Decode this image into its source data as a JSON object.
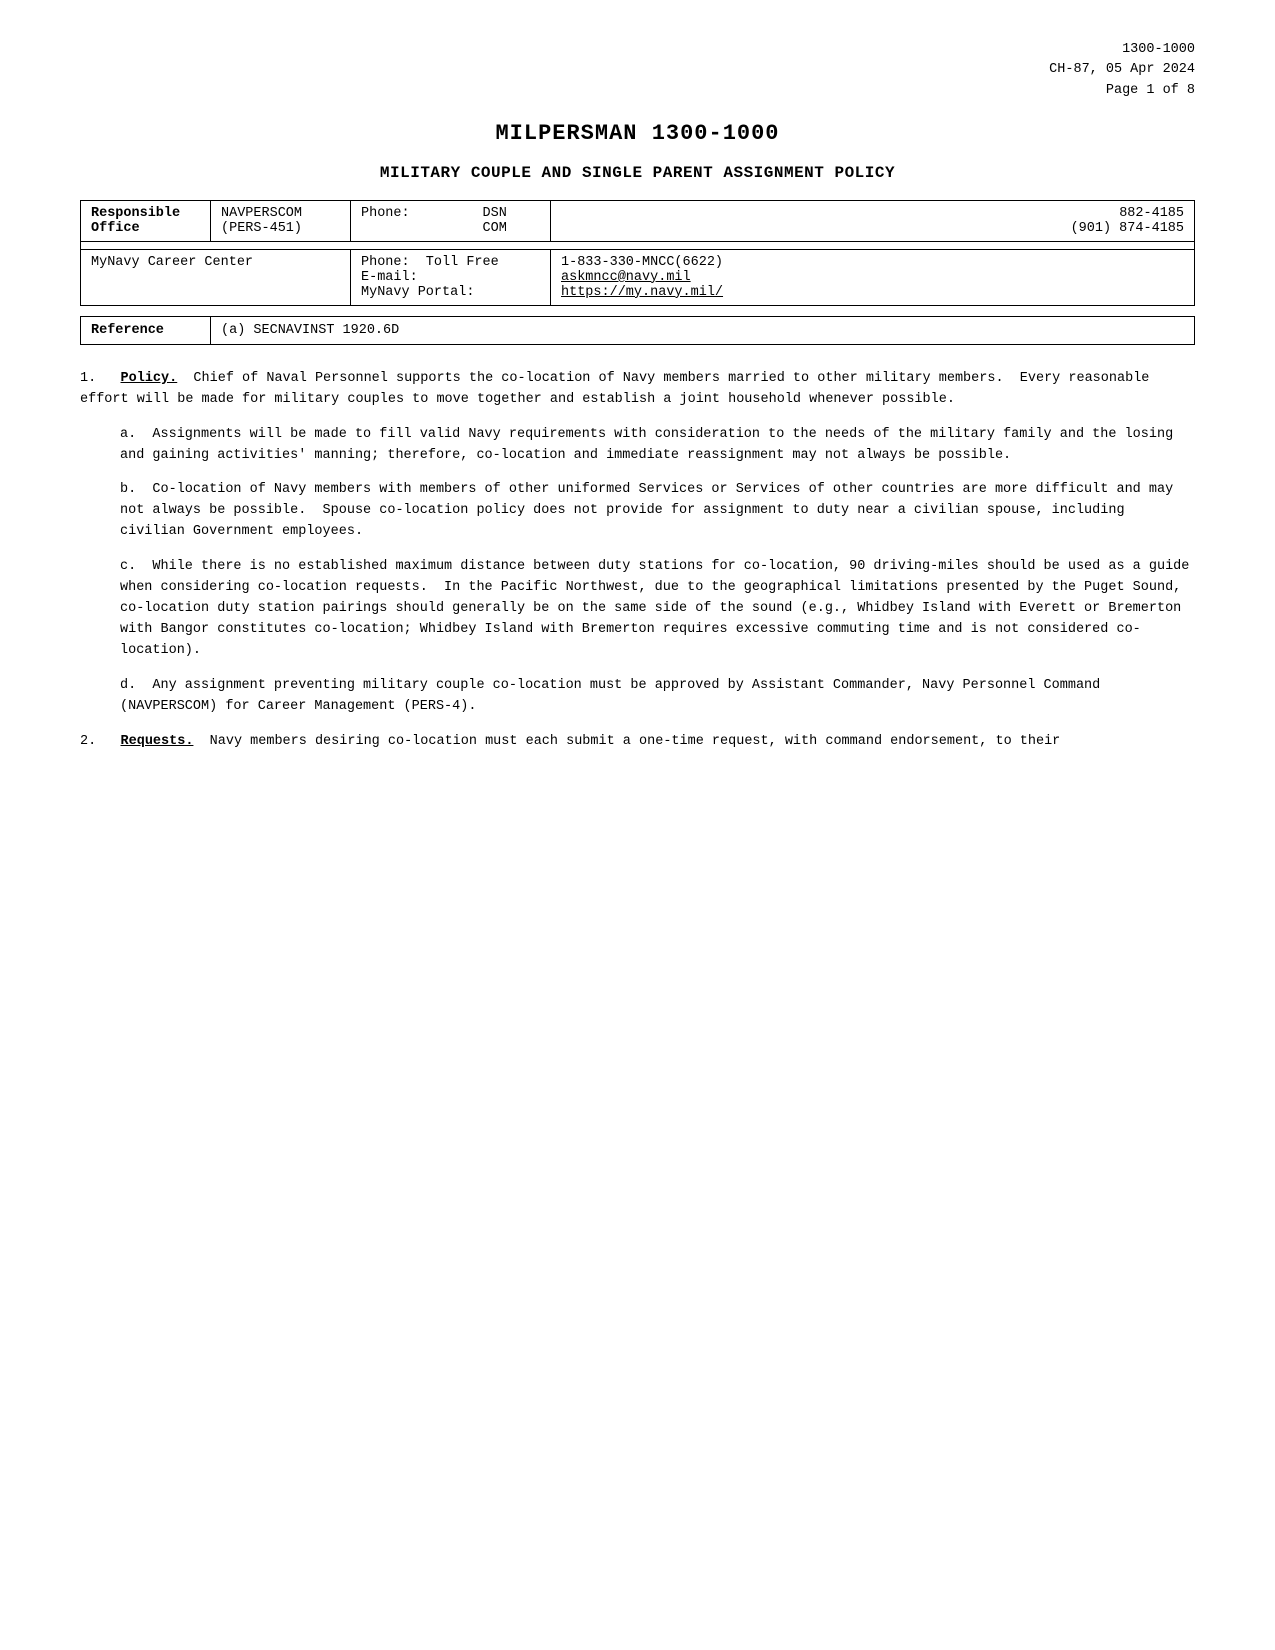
{
  "header": {
    "line1": "1300-1000",
    "line2": "CH-87, 05 Apr 2024",
    "line3": "Page 1 of 8"
  },
  "doc_title": "MILPERSMAN 1300-1000",
  "section_title": "Military Couple and Single Parent Assignment Policy",
  "table1": {
    "row1": {
      "col1_label": "Responsible\nOffice",
      "col2": "NAVPERSCOM\n(PERS-451)",
      "col3_label": "Phone:",
      "col3_dsn": "DSN",
      "col3_com": "COM",
      "col4_dsn_num": "882-4185",
      "col4_com_num": "(901) 874-4185"
    },
    "row2": {
      "col1": "MyNavy Career Center",
      "col2_label1": "Phone:",
      "col2_val1": "Toll Free",
      "col2_label2": "E-mail:",
      "col2_label3": "MyNavy Portal:",
      "col3_phone": "1-833-330-MNCC(6622)",
      "col3_email": "askmncc@navy.mil",
      "col3_portal": "https://my.navy.mil/"
    }
  },
  "ref_table": {
    "label": "Reference",
    "value": "(a) SECNAVINST 1920.6D"
  },
  "section1": {
    "num": "1.",
    "title": "Policy.",
    "text": "  Chief of Naval Personnel supports the co-location of Navy members married to other military members.  Every reasonable effort will be made for military couples to move together and establish a joint household whenever possible."
  },
  "para_a": {
    "label": "a.",
    "text": "  Assignments will be made to fill valid Navy requirements with consideration to the needs of the military family and the losing and gaining activities' manning; therefore, co-location and immediate reassignment may not always be possible."
  },
  "para_b": {
    "label": "b.",
    "text": "  Co-location of Navy members with members of other uniformed Services or Services of other countries are more difficult and may not always be possible.  Spouse co-location policy does not provide for assignment to duty near a civilian spouse, including civilian Government employees."
  },
  "para_c": {
    "label": "c.",
    "text": "  While there is no established maximum distance between duty stations for co-location, 90 driving-miles should be used as a guide when considering co-location requests.  In the Pacific Northwest, due to the geographical limitations presented by the Puget Sound, co-location duty station pairings should generally be on the same side of the sound (e.g., Whidbey Island with Everett or Bremerton with Bangor constitutes co-location; Whidbey Island with Bremerton requires excessive commuting time and is not considered co-location)."
  },
  "para_d": {
    "label": "d.",
    "text": "  Any assignment preventing military couple co-location must be approved by Assistant Commander, Navy Personnel Command (NAVPERSCOM) for Career Management (PERS-4)."
  },
  "section2": {
    "num": "2.",
    "title": "Requests.",
    "text": "  Navy members desiring co-location must each submit a one-time request, with command endorsement, to their"
  },
  "page_of": "of"
}
